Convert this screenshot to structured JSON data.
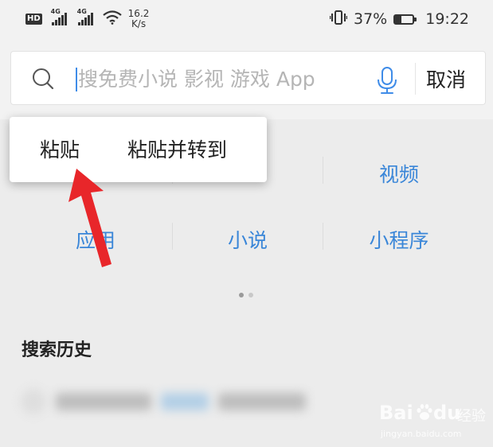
{
  "status_bar": {
    "hd_label": "HD",
    "signal1_label": "4G",
    "signal2_label": "4G",
    "net_speed_value": "16.2",
    "net_speed_unit": "K/s",
    "battery_percent": "37%",
    "battery_level": 0.37,
    "time": "19:22"
  },
  "search": {
    "placeholder": "搜免费小说 影视 游戏 App",
    "cancel_label": "取消",
    "accent_color": "#3f8ce8"
  },
  "context_menu": {
    "paste_label": "粘贴",
    "paste_and_go_label": "粘贴并转到"
  },
  "quick_links": {
    "row1": [
      "视频"
    ],
    "row2": [
      "应用",
      "小说",
      "小程序"
    ],
    "link_color": "#3a86d8"
  },
  "history": {
    "title": "搜索历史"
  },
  "watermark": {
    "brand_bai": "Bai",
    "brand_du": "du",
    "brand_suffix": "经验",
    "url": "jingyan.baidu.com"
  },
  "icons": {
    "search": "search-icon",
    "mic": "microphone-icon",
    "vibrate": "vibrate-icon",
    "wifi": "wifi-icon",
    "annotation": "red-arrow-icon"
  }
}
